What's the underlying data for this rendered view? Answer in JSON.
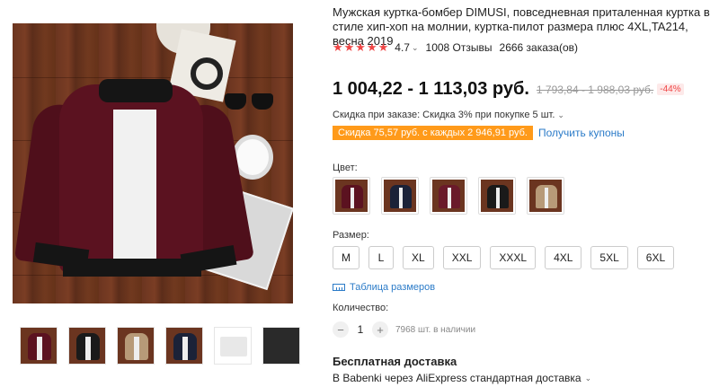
{
  "product": {
    "title": "Мужская куртка-бомбер DIMUSI, повседневная приталенная куртка в стиле хип-хоп на молнии, куртка-пилот размера плюс 4XL,TA214, весна 2019",
    "stars": "★★★★★",
    "rating": "4.7",
    "reviews": "1008 Отзывы",
    "orders": "2666 заказа(ов)"
  },
  "price": {
    "current": "1 004,22 - 1 113,03 руб.",
    "old": "1 793,84 - 1 988,03 руб.",
    "discount": "-44%"
  },
  "promo": {
    "order_discount": "Скидка при заказе: Скидка 3% при покупке 5 шт.",
    "coupon_tag": "Скидка 75,57 руб. с каждых 2 946,91 руб.",
    "coupon_link": "Получить купоны"
  },
  "options": {
    "color_label": "Цвет:",
    "colors": [
      {
        "name": "wine-red",
        "hex": "#5b1220"
      },
      {
        "name": "navy",
        "hex": "#1b2238"
      },
      {
        "name": "burgundy",
        "hex": "#6a1a2a"
      },
      {
        "name": "black",
        "hex": "#1a1a1a"
      },
      {
        "name": "khaki",
        "hex": "#b79a78"
      }
    ],
    "size_label": "Размер:",
    "sizes": [
      "M",
      "L",
      "XL",
      "XXL",
      "XXXL",
      "4XL",
      "5XL",
      "6XL"
    ],
    "size_chart": "Таблица размеров"
  },
  "quantity": {
    "label": "Количество:",
    "value": "1",
    "minus": "−",
    "plus": "+",
    "stock": "7968 шт. в наличии"
  },
  "shipping": {
    "title": "Бесплатная доставка",
    "desc": "В Babenki через AliExpress стандартная доставка"
  },
  "gallery": {
    "thumbnails": [
      {
        "hex": "#5b1220"
      },
      {
        "hex": "#1a1a1a"
      },
      {
        "hex": "#b79a78"
      },
      {
        "hex": "#1b2238"
      },
      {
        "hex": "#e8e8e8"
      },
      {
        "hex": "#2a2a2a"
      }
    ]
  },
  "icons": {
    "chevron": "⌄"
  }
}
